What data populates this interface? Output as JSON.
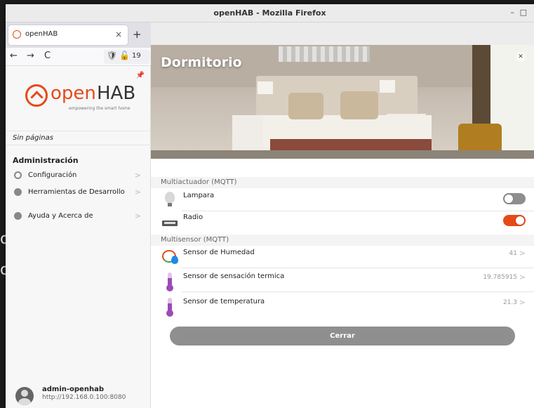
{
  "window": {
    "title": "openHAB - Mozilla Firefox",
    "minimize": "–",
    "maximize": "□"
  },
  "backdrop": {
    "line1": "o",
    "line2": "o"
  },
  "browser": {
    "tab_label": "openHAB",
    "tab_close": "×",
    "new_tab": "+",
    "back": "←",
    "forward": "→",
    "reload": "C",
    "url": "19"
  },
  "sidebar": {
    "logo_open": "open",
    "logo_hab": "HAB",
    "logo_tagline": "empowering the smart home",
    "no_pages": "Sin páginas",
    "admin_title": "Administración",
    "items": [
      {
        "label": "Configuración",
        "icon": "gear-icon"
      },
      {
        "label": "Herramientas de Desarrollo",
        "icon": "developer-tools-icon"
      },
      {
        "label": "Ayuda y Acerca de",
        "icon": "help-icon"
      }
    ],
    "chevron": ">",
    "user": {
      "name": "admin-openhab",
      "url": "http://192.168.0.100:8080"
    }
  },
  "card": {
    "title": "Dormitorio",
    "sections": [
      {
        "label": "Multiactuador (MQTT)",
        "rows": [
          {
            "label": "Lampara",
            "icon": "bulb-icon",
            "toggle": "off"
          },
          {
            "label": "Radio",
            "icon": "radio-icon",
            "toggle": "on"
          }
        ]
      },
      {
        "label": "Multisensor (MQTT)",
        "rows": [
          {
            "label": "Sensor de Humedad",
            "icon": "humidity-icon",
            "value": "41"
          },
          {
            "label": "Sensor de sensación termica",
            "icon": "thermometer-icon",
            "value": "19.785915"
          },
          {
            "label": "Sensor de temperatura",
            "icon": "thermometer-icon",
            "value": "21.3"
          }
        ]
      }
    ],
    "close_label": "Cerrar",
    "chevron": ">"
  },
  "colors": {
    "accent": "#e64a19",
    "toggle_off": "#8e8e8e",
    "close_button": "#8f8f8f"
  }
}
